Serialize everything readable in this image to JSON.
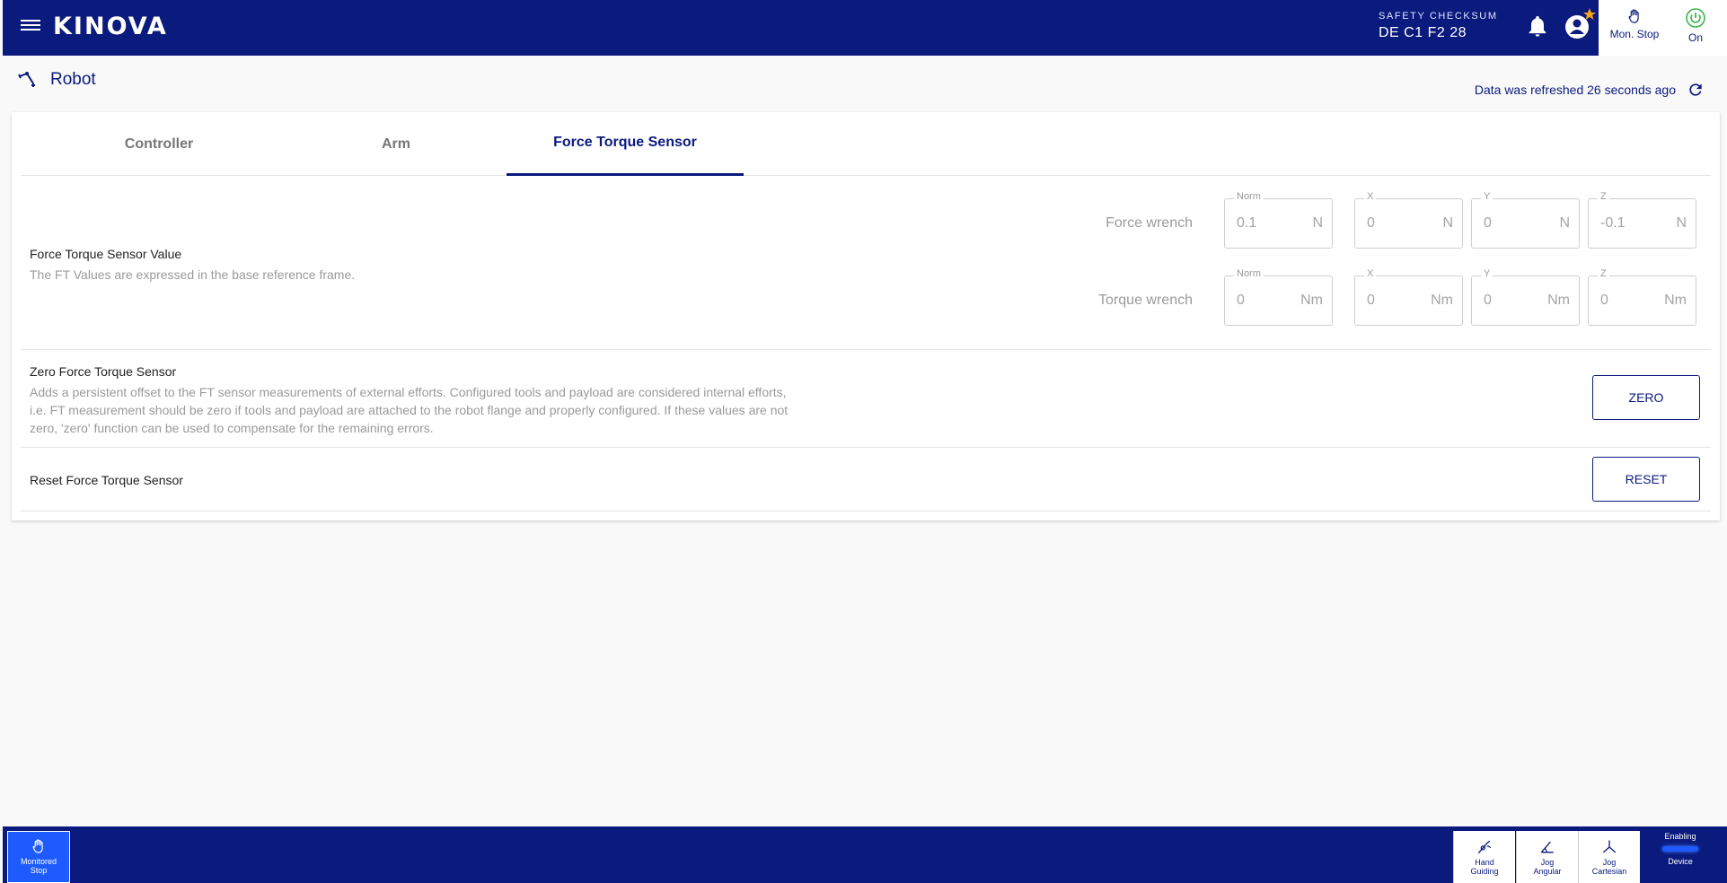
{
  "header": {
    "logo": "KINOVA",
    "safety_label": "SAFETY CHECKSUM",
    "safety_value": "DE C1 F2 28",
    "mon_stop_label": "Mon. Stop",
    "power_label": "On"
  },
  "page": {
    "title": "Robot",
    "refresh_text": "Data was refreshed 26 seconds ago"
  },
  "tabs": [
    {
      "label": "Controller"
    },
    {
      "label": "Arm"
    },
    {
      "label": "Force Torque Sensor"
    }
  ],
  "ft_value": {
    "title": "Force Torque Sensor Value",
    "description": "The FT Values are expressed in the base reference frame.",
    "force": {
      "label": "Force wrench",
      "fields": [
        {
          "legend": "Norm",
          "value": "0.1",
          "unit": "N"
        },
        {
          "legend": "X",
          "value": "0",
          "unit": "N"
        },
        {
          "legend": "Y",
          "value": "0",
          "unit": "N"
        },
        {
          "legend": "Z",
          "value": "-0.1",
          "unit": "N"
        }
      ]
    },
    "torque": {
      "label": "Torque wrench",
      "fields": [
        {
          "legend": "Norm",
          "value": "0",
          "unit": "Nm"
        },
        {
          "legend": "X",
          "value": "0",
          "unit": "Nm"
        },
        {
          "legend": "Y",
          "value": "0",
          "unit": "Nm"
        },
        {
          "legend": "Z",
          "value": "0",
          "unit": "Nm"
        }
      ]
    }
  },
  "zero": {
    "title": "Zero Force Torque Sensor",
    "description": "Adds a persistent offset to the FT sensor measurements of external efforts. Configured tools and payload are considered internal efforts, i.e. FT measurement should be zero if tools and payload are attached to the robot flange and properly configured. If these values are not zero, 'zero' function can be used to compensate for the remaining errors.",
    "button": "ZERO"
  },
  "reset": {
    "title": "Reset Force Torque Sensor",
    "button": "RESET"
  },
  "footer": {
    "monitored_stop": [
      "Monitored",
      "Stop"
    ],
    "hand_guiding": [
      "Hand",
      "Guiding"
    ],
    "jog_angular": [
      "Jog",
      "Angular"
    ],
    "jog_cartesian": [
      "Jog",
      "Cartesian"
    ],
    "enabling": "Enabling",
    "device": "Device"
  },
  "colors": {
    "brand": "#0a1a7d",
    "accent": "#1e5bff",
    "power_green": "#3bb54a",
    "star_orange": "#f7a21b"
  }
}
